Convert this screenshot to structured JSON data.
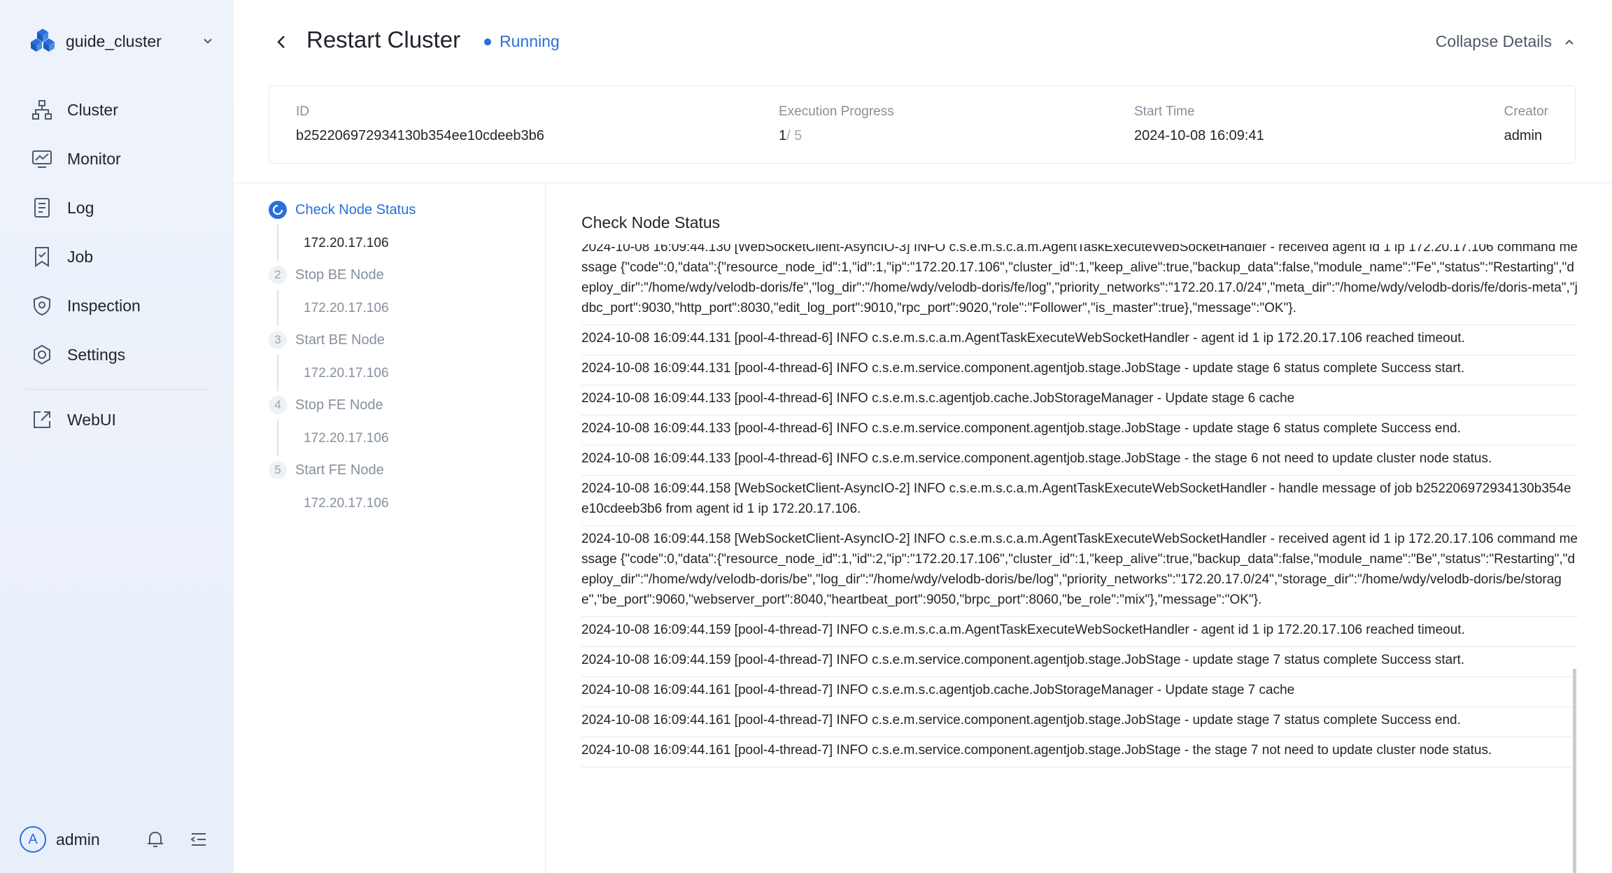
{
  "sidebar": {
    "cluster_name": "guide_cluster",
    "nav": [
      {
        "label": "Cluster",
        "icon": "cluster-icon"
      },
      {
        "label": "Monitor",
        "icon": "monitor-icon"
      },
      {
        "label": "Log",
        "icon": "log-icon"
      },
      {
        "label": "Job",
        "icon": "job-icon"
      },
      {
        "label": "Inspection",
        "icon": "inspection-icon"
      },
      {
        "label": "Settings",
        "icon": "settings-icon"
      }
    ],
    "webui_label": "WebUI",
    "user": {
      "avatar_letter": "A",
      "name": "admin"
    }
  },
  "header": {
    "title": "Restart Cluster",
    "status": "Running",
    "collapse_label": "Collapse Details"
  },
  "details": {
    "id_label": "ID",
    "id_value": "b252206972934130b354ee10cdeeb3b6",
    "progress_label": "Execution Progress",
    "progress_current": "1",
    "progress_sep": "/",
    "progress_total": "5",
    "start_label": "Start Time",
    "start_value": "2024-10-08 16:09:41",
    "creator_label": "Creator",
    "creator_value": "admin"
  },
  "steps": [
    {
      "num": "1",
      "name": "Check Node Status",
      "node": "172.20.17.106",
      "active": true
    },
    {
      "num": "2",
      "name": "Stop BE Node",
      "node": "172.20.17.106",
      "active": false
    },
    {
      "num": "3",
      "name": "Start BE Node",
      "node": "172.20.17.106",
      "active": false
    },
    {
      "num": "4",
      "name": "Stop FE Node",
      "node": "172.20.17.106",
      "active": false
    },
    {
      "num": "5",
      "name": "Start FE Node",
      "node": "172.20.17.106",
      "active": false
    }
  ],
  "log": {
    "title": "Check Node Status",
    "entries": [
      "2024-10-08 16:09:44.130 [WebSocketClient-AsyncIO-3] INFO  c.s.e.m.s.c.a.m.AgentTaskExecuteWebSocketHandler - received agent id 1 ip 172.20.17.106 command message {\"code\":0,\"data\":{\"resource_node_id\":1,\"id\":1,\"ip\":\"172.20.17.106\",\"cluster_id\":1,\"keep_alive\":true,\"backup_data\":false,\"module_name\":\"Fe\",\"status\":\"Restarting\",\"deploy_dir\":\"/home/wdy/velodb-doris/fe\",\"log_dir\":\"/home/wdy/velodb-doris/fe/log\",\"priority_networks\":\"172.20.17.0/24\",\"meta_dir\":\"/home/wdy/velodb-doris/fe/doris-meta\",\"jdbc_port\":9030,\"http_port\":8030,\"edit_log_port\":9010,\"rpc_port\":9020,\"role\":\"Follower\",\"is_master\":true},\"message\":\"OK\"}.",
      "2024-10-08 16:09:44.131 [pool-4-thread-6] INFO  c.s.e.m.s.c.a.m.AgentTaskExecuteWebSocketHandler - agent id 1 ip 172.20.17.106 reached timeout.",
      "2024-10-08 16:09:44.131 [pool-4-thread-6] INFO  c.s.e.m.service.component.agentjob.stage.JobStage - update stage 6 status complete Success start.",
      "2024-10-08 16:09:44.133 [pool-4-thread-6] INFO  c.s.e.m.s.c.agentjob.cache.JobStorageManager - Update stage 6 cache",
      "2024-10-08 16:09:44.133 [pool-4-thread-6] INFO  c.s.e.m.service.component.agentjob.stage.JobStage - update stage 6 status complete Success end.",
      "2024-10-08 16:09:44.133 [pool-4-thread-6] INFO  c.s.e.m.service.component.agentjob.stage.JobStage - the stage 6 not need to update cluster node status.",
      "2024-10-08 16:09:44.158 [WebSocketClient-AsyncIO-2] INFO  c.s.e.m.s.c.a.m.AgentTaskExecuteWebSocketHandler - handle message of job b252206972934130b354ee10cdeeb3b6 from agent id 1 ip 172.20.17.106.",
      "2024-10-08 16:09:44.158 [WebSocketClient-AsyncIO-2] INFO  c.s.e.m.s.c.a.m.AgentTaskExecuteWebSocketHandler - received agent id 1 ip 172.20.17.106 command message {\"code\":0,\"data\":{\"resource_node_id\":1,\"id\":2,\"ip\":\"172.20.17.106\",\"cluster_id\":1,\"keep_alive\":true,\"backup_data\":false,\"module_name\":\"Be\",\"status\":\"Restarting\",\"deploy_dir\":\"/home/wdy/velodb-doris/be\",\"log_dir\":\"/home/wdy/velodb-doris/be/log\",\"priority_networks\":\"172.20.17.0/24\",\"storage_dir\":\"/home/wdy/velodb-doris/be/storage\",\"be_port\":9060,\"webserver_port\":8040,\"heartbeat_port\":9050,\"brpc_port\":8060,\"be_role\":\"mix\"},\"message\":\"OK\"}.",
      "2024-10-08 16:09:44.159 [pool-4-thread-7] INFO  c.s.e.m.s.c.a.m.AgentTaskExecuteWebSocketHandler - agent id 1 ip 172.20.17.106 reached timeout.",
      "2024-10-08 16:09:44.159 [pool-4-thread-7] INFO  c.s.e.m.service.component.agentjob.stage.JobStage - update stage 7 status complete Success start.",
      "2024-10-08 16:09:44.161 [pool-4-thread-7] INFO  c.s.e.m.s.c.agentjob.cache.JobStorageManager - Update stage 7 cache",
      "2024-10-08 16:09:44.161 [pool-4-thread-7] INFO  c.s.e.m.service.component.agentjob.stage.JobStage - update stage 7 status complete Success end.",
      "2024-10-08 16:09:44.161 [pool-4-thread-7] INFO  c.s.e.m.service.component.agentjob.stage.JobStage - the stage 7 not need to update cluster node status."
    ]
  },
  "colors": {
    "accent": "#2a6fdb",
    "sidebar_bg": "#eef3fb",
    "muted_text": "#86909c",
    "border": "#e6e9ef"
  }
}
